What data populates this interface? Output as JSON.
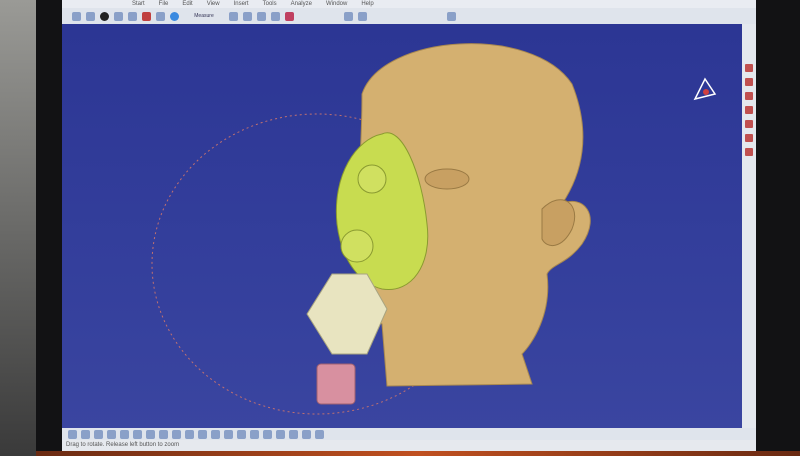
{
  "menu": [
    "Start",
    "File",
    "Edit",
    "View",
    "Insert",
    "Tools",
    "Analyze",
    "Window",
    "Help"
  ],
  "toolbar": {
    "label": "Measure"
  },
  "status": {
    "text": "Drag to rotate. Release left button to zoom"
  },
  "colors": {
    "viewport": "#2f3a96",
    "head": "#d4b070",
    "mask": "#c8dc50",
    "valve": "#e8e4c0",
    "tube": "#d890a0"
  }
}
